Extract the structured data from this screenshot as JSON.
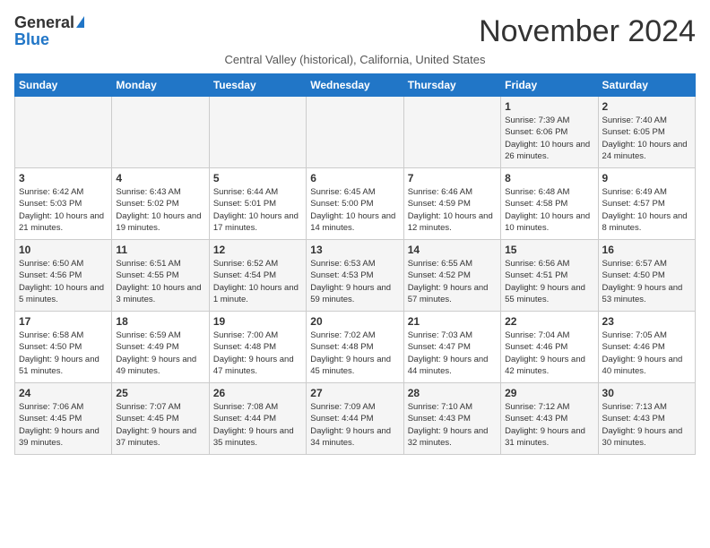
{
  "header": {
    "logo_general": "General",
    "logo_blue": "Blue",
    "month_title": "November 2024",
    "subtitle": "Central Valley (historical), California, United States"
  },
  "days_of_week": [
    "Sunday",
    "Monday",
    "Tuesday",
    "Wednesday",
    "Thursday",
    "Friday",
    "Saturday"
  ],
  "weeks": [
    [
      {
        "day": "",
        "detail": ""
      },
      {
        "day": "",
        "detail": ""
      },
      {
        "day": "",
        "detail": ""
      },
      {
        "day": "",
        "detail": ""
      },
      {
        "day": "",
        "detail": ""
      },
      {
        "day": "1",
        "detail": "Sunrise: 7:39 AM\nSunset: 6:06 PM\nDaylight: 10 hours and 26 minutes."
      },
      {
        "day": "2",
        "detail": "Sunrise: 7:40 AM\nSunset: 6:05 PM\nDaylight: 10 hours and 24 minutes."
      }
    ],
    [
      {
        "day": "3",
        "detail": "Sunrise: 6:42 AM\nSunset: 5:03 PM\nDaylight: 10 hours and 21 minutes."
      },
      {
        "day": "4",
        "detail": "Sunrise: 6:43 AM\nSunset: 5:02 PM\nDaylight: 10 hours and 19 minutes."
      },
      {
        "day": "5",
        "detail": "Sunrise: 6:44 AM\nSunset: 5:01 PM\nDaylight: 10 hours and 17 minutes."
      },
      {
        "day": "6",
        "detail": "Sunrise: 6:45 AM\nSunset: 5:00 PM\nDaylight: 10 hours and 14 minutes."
      },
      {
        "day": "7",
        "detail": "Sunrise: 6:46 AM\nSunset: 4:59 PM\nDaylight: 10 hours and 12 minutes."
      },
      {
        "day": "8",
        "detail": "Sunrise: 6:48 AM\nSunset: 4:58 PM\nDaylight: 10 hours and 10 minutes."
      },
      {
        "day": "9",
        "detail": "Sunrise: 6:49 AM\nSunset: 4:57 PM\nDaylight: 10 hours and 8 minutes."
      }
    ],
    [
      {
        "day": "10",
        "detail": "Sunrise: 6:50 AM\nSunset: 4:56 PM\nDaylight: 10 hours and 5 minutes."
      },
      {
        "day": "11",
        "detail": "Sunrise: 6:51 AM\nSunset: 4:55 PM\nDaylight: 10 hours and 3 minutes."
      },
      {
        "day": "12",
        "detail": "Sunrise: 6:52 AM\nSunset: 4:54 PM\nDaylight: 10 hours and 1 minute."
      },
      {
        "day": "13",
        "detail": "Sunrise: 6:53 AM\nSunset: 4:53 PM\nDaylight: 9 hours and 59 minutes."
      },
      {
        "day": "14",
        "detail": "Sunrise: 6:55 AM\nSunset: 4:52 PM\nDaylight: 9 hours and 57 minutes."
      },
      {
        "day": "15",
        "detail": "Sunrise: 6:56 AM\nSunset: 4:51 PM\nDaylight: 9 hours and 55 minutes."
      },
      {
        "day": "16",
        "detail": "Sunrise: 6:57 AM\nSunset: 4:50 PM\nDaylight: 9 hours and 53 minutes."
      }
    ],
    [
      {
        "day": "17",
        "detail": "Sunrise: 6:58 AM\nSunset: 4:50 PM\nDaylight: 9 hours and 51 minutes."
      },
      {
        "day": "18",
        "detail": "Sunrise: 6:59 AM\nSunset: 4:49 PM\nDaylight: 9 hours and 49 minutes."
      },
      {
        "day": "19",
        "detail": "Sunrise: 7:00 AM\nSunset: 4:48 PM\nDaylight: 9 hours and 47 minutes."
      },
      {
        "day": "20",
        "detail": "Sunrise: 7:02 AM\nSunset: 4:48 PM\nDaylight: 9 hours and 45 minutes."
      },
      {
        "day": "21",
        "detail": "Sunrise: 7:03 AM\nSunset: 4:47 PM\nDaylight: 9 hours and 44 minutes."
      },
      {
        "day": "22",
        "detail": "Sunrise: 7:04 AM\nSunset: 4:46 PM\nDaylight: 9 hours and 42 minutes."
      },
      {
        "day": "23",
        "detail": "Sunrise: 7:05 AM\nSunset: 4:46 PM\nDaylight: 9 hours and 40 minutes."
      }
    ],
    [
      {
        "day": "24",
        "detail": "Sunrise: 7:06 AM\nSunset: 4:45 PM\nDaylight: 9 hours and 39 minutes."
      },
      {
        "day": "25",
        "detail": "Sunrise: 7:07 AM\nSunset: 4:45 PM\nDaylight: 9 hours and 37 minutes."
      },
      {
        "day": "26",
        "detail": "Sunrise: 7:08 AM\nSunset: 4:44 PM\nDaylight: 9 hours and 35 minutes."
      },
      {
        "day": "27",
        "detail": "Sunrise: 7:09 AM\nSunset: 4:44 PM\nDaylight: 9 hours and 34 minutes."
      },
      {
        "day": "28",
        "detail": "Sunrise: 7:10 AM\nSunset: 4:43 PM\nDaylight: 9 hours and 32 minutes."
      },
      {
        "day": "29",
        "detail": "Sunrise: 7:12 AM\nSunset: 4:43 PM\nDaylight: 9 hours and 31 minutes."
      },
      {
        "day": "30",
        "detail": "Sunrise: 7:13 AM\nSunset: 4:43 PM\nDaylight: 9 hours and 30 minutes."
      }
    ]
  ]
}
